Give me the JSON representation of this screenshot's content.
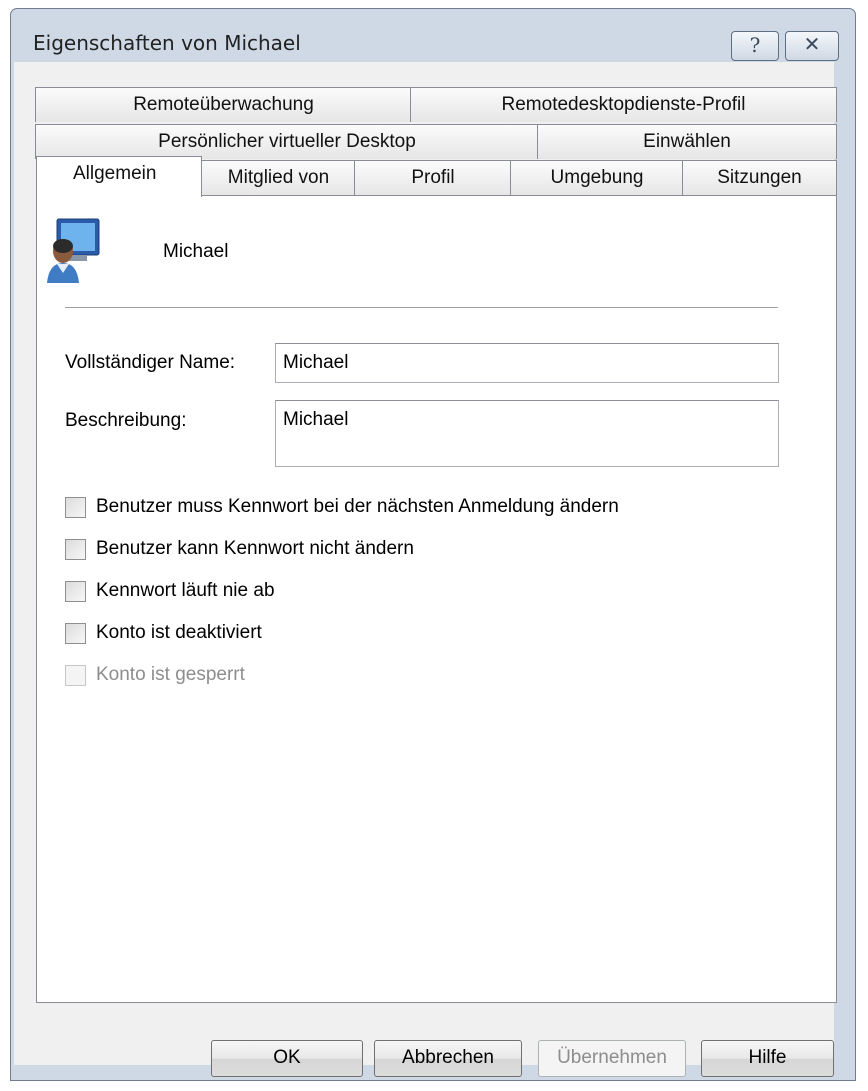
{
  "window": {
    "title": "Eigenschaften von Michael",
    "help_glyph": "?",
    "close_glyph": "✕"
  },
  "tabs": {
    "row1": [
      "Remoteüberwachung",
      "Remotedesktopdienste-Profil"
    ],
    "row2": [
      "Persönlicher virtueller Desktop",
      "Einwählen"
    ],
    "row3": [
      "Allgemein",
      "Mitglied von",
      "Profil",
      "Umgebung",
      "Sitzungen"
    ],
    "active": "Allgemein"
  },
  "user": {
    "icon": "user-icon",
    "name": "Michael"
  },
  "form": {
    "full_name_label": "Vollständiger Name:",
    "full_name_value": "Michael",
    "description_label": "Beschreibung:",
    "description_value": "Michael"
  },
  "checkboxes": [
    {
      "label": "Benutzer muss Kennwort bei der nächsten Anmeldung ändern",
      "checked": false,
      "enabled": true
    },
    {
      "label": "Benutzer kann Kennwort nicht ändern",
      "checked": false,
      "enabled": true
    },
    {
      "label": "Kennwort läuft nie ab",
      "checked": false,
      "enabled": true
    },
    {
      "label": "Konto ist deaktiviert",
      "checked": false,
      "enabled": true
    },
    {
      "label": "Konto ist gesperrt",
      "checked": false,
      "enabled": false
    }
  ],
  "buttons": {
    "ok": "OK",
    "cancel": "Abbrechen",
    "apply": "Übernehmen",
    "help": "Hilfe"
  }
}
